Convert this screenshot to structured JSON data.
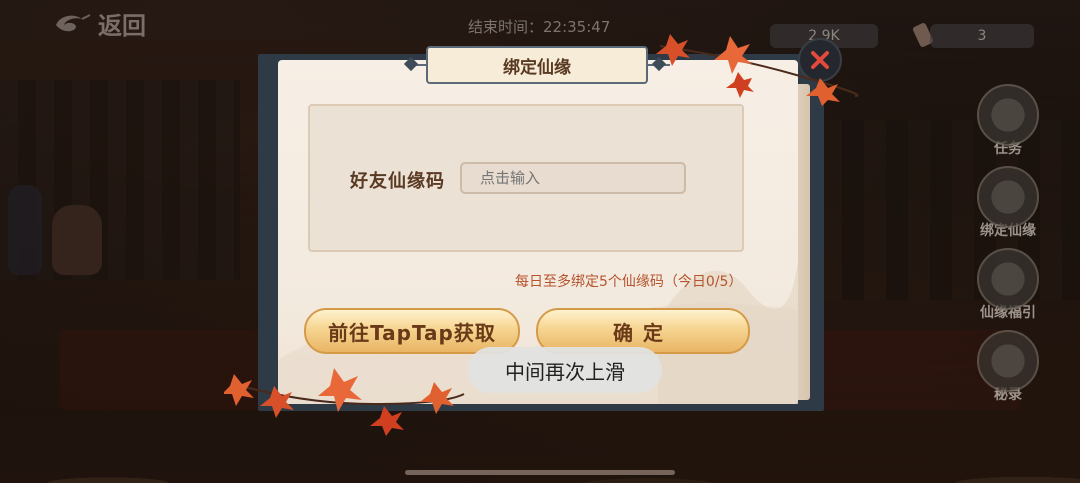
{
  "top_bar": {
    "back_label": "返回",
    "end_time_label": "结束时间：22:35:47",
    "resource_1": "2.9K",
    "resource_2": "3"
  },
  "side_menu": [
    {
      "label": "任务",
      "icon": "scroll-icon"
    },
    {
      "label": "绑定仙缘",
      "icon": "bind-icon"
    },
    {
      "label": "仙缘福引",
      "icon": "scroll-bundle-icon"
    },
    {
      "label": "秘录",
      "icon": "book-icon"
    }
  ],
  "dialog": {
    "title": "绑定仙缘",
    "field_label": "好友仙缘码",
    "field_placeholder": "点击输入",
    "field_value": "",
    "limit_note": "每日至多绑定5个仙缘码（今日0/5）",
    "button_taptap": "前往TapTap获取",
    "button_confirm": "确定"
  },
  "toast": "中间再次上滑",
  "colors": {
    "title_text": "#5a3a22",
    "note_text": "#b5542c",
    "button_gold": "#f6d490",
    "frame_slate": "#2e3a46"
  }
}
